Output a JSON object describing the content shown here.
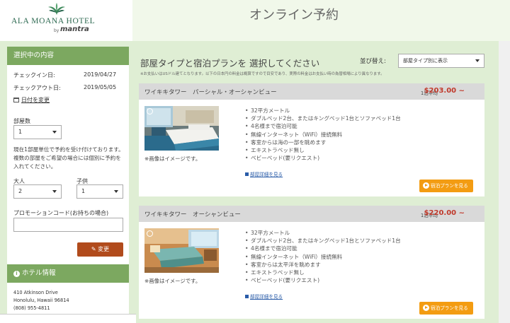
{
  "logo": {
    "name": "ALA MOANA HOTEL",
    "by": "by",
    "brand": "mantra"
  },
  "header": {
    "title": "オンライン予約"
  },
  "sidebar": {
    "heading": "選択中の内容",
    "checkin_label": "チェックイン日:",
    "checkin_value": "2019/04/27",
    "checkout_label": "チェックアウト日:",
    "checkout_value": "2019/05/05",
    "change_dates": "日付を変更",
    "rooms_label": "部屋数",
    "rooms_value": "1",
    "note": "現在1部屋単位で予約を受け付けております。複数の部屋をご希望の場合には個別に予約を入れてください。",
    "adults_label": "大人",
    "adults_value": "2",
    "children_label": "子供",
    "children_value": "1",
    "promo_label": "プロモーションコード(お持ちの場合)",
    "promo_value": "",
    "change_button": "変更",
    "hotel_heading": "ホテル情報",
    "address": [
      "410 Atkinson Drive",
      "Honolulu, Hawaii 96814",
      "(808) 955-4811"
    ]
  },
  "main": {
    "title": "部屋タイプと宿泊プランを 選択してください",
    "sort_label": "並び替え:",
    "sort_value": "部屋タイプ別に表示",
    "disclaimer": "※お支払いはUSドル建てとなります。以下の日本円の料金は概算ですので目安であり、実際の料金はお支払い時の為替相場により異なります。",
    "rooms": [
      {
        "name": "ワイキキタワー　パーシャル・オーシャンビュー",
        "price_label": "1泊平均",
        "price": "$203.00 ~",
        "photo_caption": "※画像はイメージです。",
        "features": [
          "32平方メートル",
          "ダブルベッド2台、またはキングベッド1台とソファベッド1台",
          "4名様まで宿泊可能",
          "無線インターネット（WiFi）接続無料",
          "客室からは海の一部を眺めます",
          "エキストラベッド無し",
          "ベビーベッド(要リクエスト)"
        ],
        "detail_link": "部屋詳細を見る",
        "plan_button": "宿泊プランを見る"
      },
      {
        "name": "ワイキキタワー　オーシャンビュー",
        "price_label": "1泊平均",
        "price": "$220.00 ~",
        "photo_caption": "※画像はイメージです。",
        "features": [
          "32平方メートル",
          "ダブルベッド2台、またはキングベッド1台とソファベッド1台",
          "4名様まで宿泊可能",
          "無線インターネット（WiFi）接続無料",
          "客室からは太平洋を眺めます",
          "エキストラベッド無し",
          "ベビーベッド(要リクエスト)"
        ],
        "detail_link": "部屋詳細を見る",
        "plan_button": "宿泊プランを見る"
      }
    ]
  },
  "colors": {
    "accent_green": "#7ca860",
    "price_red": "#c0392b",
    "orange": "#f39c12",
    "change_btn": "#b14b1c"
  }
}
